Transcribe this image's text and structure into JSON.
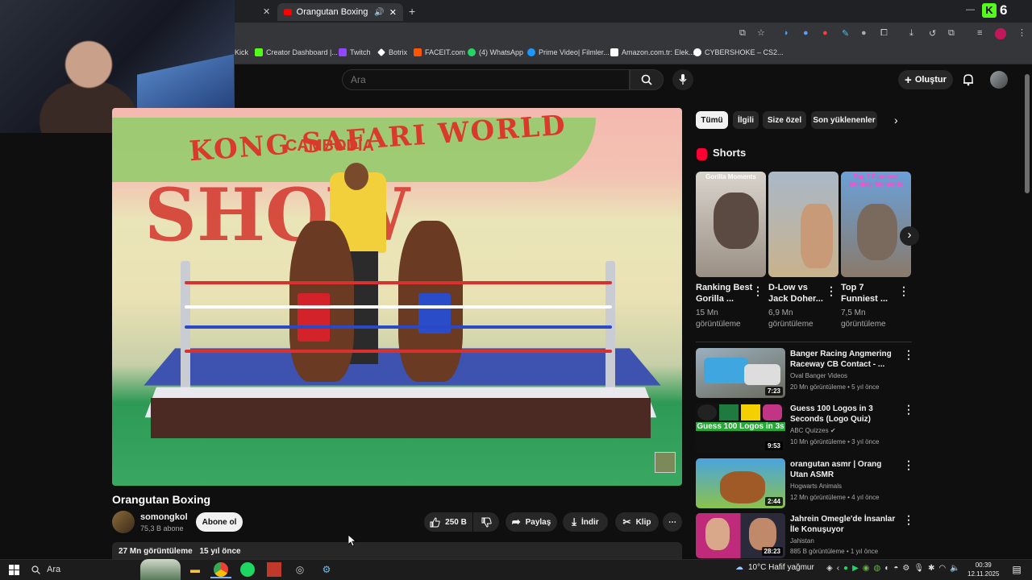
{
  "browser": {
    "tabs": [
      {
        "label": "Orangutan Boxing - YouTube",
        "active": true
      }
    ],
    "new_tab_symbol": "+",
    "bookmarks": [
      {
        "label": "Kick",
        "color": "#53fc18"
      },
      {
        "label": "Creator Dashboard |...",
        "color": "#53fc18"
      },
      {
        "label": "Twitch",
        "color": "#9146ff"
      },
      {
        "label": "Botrix",
        "color": "#ffffff"
      },
      {
        "label": "FACEIT.com",
        "color": "#ff5500"
      },
      {
        "label": "(4) WhatsApp",
        "color": "#25d366"
      },
      {
        "label": "Prime Video| Filmler...",
        "color": "#1a98ff"
      },
      {
        "label": "Amazon.com.tr: Elek...",
        "color": "#ffffff"
      },
      {
        "label": "CYBERSHOKE – CS2...",
        "color": "#ffffff"
      }
    ],
    "kick_badge": "6"
  },
  "youtube": {
    "search": {
      "placeholder": "Ara"
    },
    "create_label": "Oluştur",
    "video": {
      "title": "Orangutan Boxing",
      "banner_text": "KONG SAFARI WORLD",
      "banner_sub": "CAMBODIA",
      "banner_show": "SHOW"
    },
    "channel": {
      "name": "somongkol",
      "subscribers": "75,3 B abone",
      "subscribe_label": "Abone ol"
    },
    "actions": {
      "likes": "250 B",
      "share": "Paylaş",
      "download": "İndir",
      "clip": "Klip",
      "more": "⋯"
    },
    "description": {
      "views": "27 Mn görüntüleme",
      "age": "15 yıl önce"
    },
    "chips": [
      "Tümü",
      "İlgili",
      "Size özel",
      "Son yüklenenler"
    ],
    "shorts_heading": "Shorts",
    "shorts": [
      {
        "title": "Ranking Best Gorilla ...",
        "views": "15 Mn görüntüleme",
        "thumb_text": "Gorilla Moments"
      },
      {
        "title": "D-Low vs Jack Doher...",
        "views": "6,9 Mn görüntüleme",
        "thumb_text": ""
      },
      {
        "title": "Top 7 Funniest ...",
        "views": "7,5 Mn görüntüleme",
        "thumb_text": "Top 7 Funniest Monkey Moments"
      }
    ],
    "recommended": [
      {
        "title": "Banger Racing Angmering Raceway CB Contact - ...",
        "channel": "Oval Banger Videos",
        "meta": "20 Mn görüntüleme • 5 yıl önce",
        "duration": "7:23"
      },
      {
        "title": "Guess 100 Logos in 3 Seconds (Logo Quiz)",
        "channel": "ABC Quizzes",
        "meta": "10 Mn görüntüleme • 3 yıl önce",
        "duration": "9:53",
        "thumb_text": "Guess 100 Logos in 3s"
      },
      {
        "title": "orangutan asmr | Orang Utan ASMR",
        "channel": "Hogwarts Animals",
        "meta": "12 Mn görüntüleme • 4 yıl önce",
        "duration": "2:44"
      },
      {
        "title": "Jahrein Omegle'de İnsanlar İle Konuşuyor",
        "channel": "Jahistan",
        "meta": "885 B görüntüleme • 1 yıl önce",
        "duration": "28:23"
      }
    ]
  },
  "taskbar": {
    "search_placeholder": "Ara",
    "weather": "10°C Hafif yağmur",
    "time": "00:39",
    "date": "12.11.2025"
  }
}
